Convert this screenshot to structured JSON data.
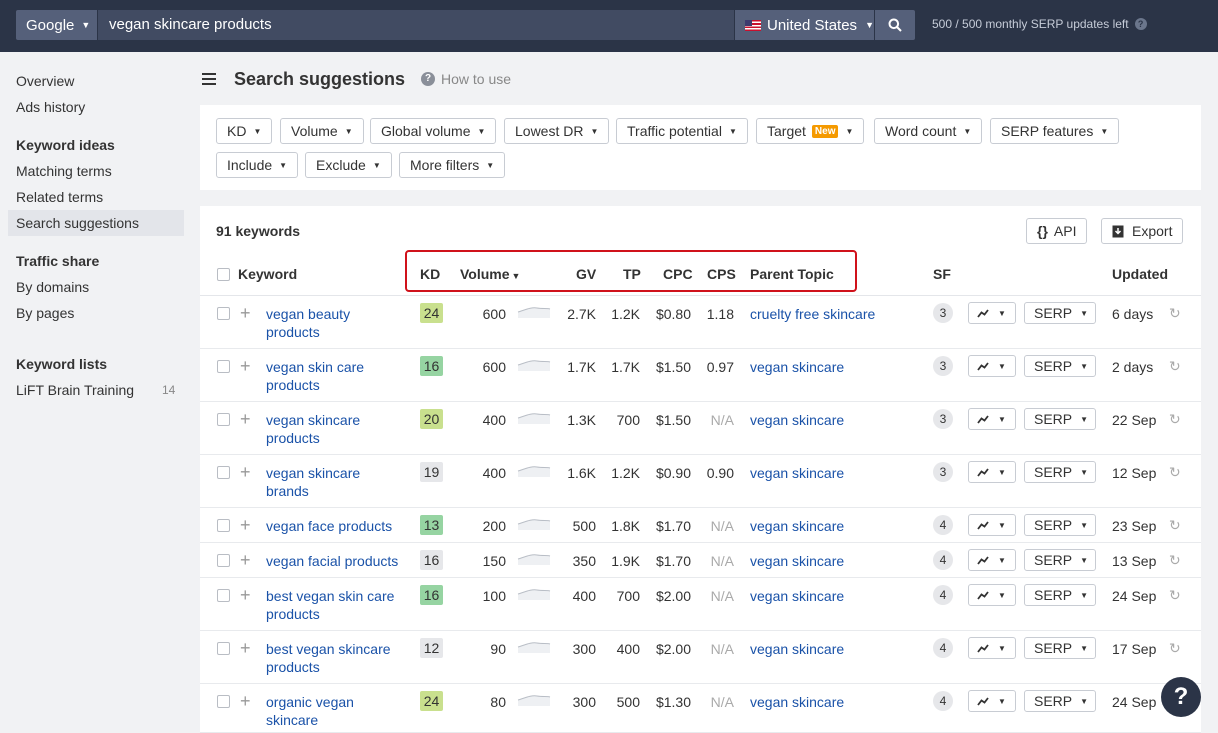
{
  "topbar": {
    "engine": "Google",
    "query": "vegan skincare products",
    "country": "United States",
    "quota": "500 / 500 monthly SERP updates left"
  },
  "sidebar": {
    "items": [
      {
        "label": "Overview"
      },
      {
        "label": "Ads history"
      }
    ],
    "keyword_ideas": {
      "heading": "Keyword ideas",
      "items": [
        {
          "label": "Matching terms"
        },
        {
          "label": "Related terms"
        },
        {
          "label": "Search suggestions"
        }
      ]
    },
    "traffic_share": {
      "heading": "Traffic share",
      "items": [
        {
          "label": "By domains"
        },
        {
          "label": "By pages"
        }
      ]
    },
    "keyword_lists": {
      "heading": "Keyword lists",
      "items": [
        {
          "label": "LiFT Brain Training",
          "count": "14"
        }
      ]
    }
  },
  "header": {
    "title": "Search suggestions",
    "how_to": "How to use"
  },
  "filters": [
    {
      "label": "KD"
    },
    {
      "label": "Volume"
    },
    {
      "label": "Global volume"
    },
    {
      "label": "Lowest DR"
    },
    {
      "label": "Traffic potential"
    },
    {
      "label": "Target",
      "badge": "New"
    },
    {
      "label": "Word count"
    },
    {
      "label": "SERP features"
    },
    {
      "label": "Include"
    },
    {
      "label": "Exclude"
    },
    {
      "label": "More filters"
    }
  ],
  "table": {
    "count": "91 keywords",
    "api_label": "API",
    "export_label": "Export",
    "headers": {
      "keyword": "Keyword",
      "kd": "KD",
      "volume": "Volume",
      "gv": "GV",
      "tp": "TP",
      "cpc": "CPC",
      "cps": "CPS",
      "parent": "Parent Topic",
      "sf": "SF",
      "updated": "Updated"
    },
    "serp_label": "SERP",
    "rows": [
      {
        "kw1": "vegan beauty",
        "kw2": "products",
        "kd": "24",
        "kd_color": "#c9e08e",
        "volume": "600",
        "gv": "2.7K",
        "tp": "1.2K",
        "cpc": "$0.80",
        "cps": "1.18",
        "parent": "cruelty free skincare",
        "sf": "3",
        "updated": "6 days"
      },
      {
        "kw1": "vegan skin care",
        "kw2": "products",
        "kd": "16",
        "kd_color": "#96d4a2",
        "volume": "600",
        "gv": "1.7K",
        "tp": "1.7K",
        "cpc": "$1.50",
        "cps": "0.97",
        "parent": "vegan skincare",
        "sf": "3",
        "updated": "2 days"
      },
      {
        "kw1": "vegan skincare",
        "kw2": "products",
        "kd": "20",
        "kd_color": "#c9e08e",
        "volume": "400",
        "gv": "1.3K",
        "tp": "700",
        "cpc": "$1.50",
        "cps": "N/A",
        "parent": "vegan skincare",
        "sf": "3",
        "updated": "22 Sep"
      },
      {
        "kw1": "vegan skincare",
        "kw2": "brands",
        "kd": "19",
        "kd_color": "#e6e7ea",
        "volume": "400",
        "gv": "1.6K",
        "tp": "1.2K",
        "cpc": "$0.90",
        "cps": "0.90",
        "parent": "vegan skincare",
        "sf": "3",
        "updated": "12 Sep"
      },
      {
        "kw1": "vegan face products",
        "kw2": "",
        "kd": "13",
        "kd_color": "#96d4a2",
        "volume": "200",
        "gv": "500",
        "tp": "1.8K",
        "cpc": "$1.70",
        "cps": "N/A",
        "parent": "vegan skincare",
        "sf": "4",
        "updated": "23 Sep"
      },
      {
        "kw1": "vegan facial products",
        "kw2": "",
        "kd": "16",
        "kd_color": "#e6e7ea",
        "volume": "150",
        "gv": "350",
        "tp": "1.9K",
        "cpc": "$1.70",
        "cps": "N/A",
        "parent": "vegan skincare",
        "sf": "4",
        "updated": "13 Sep"
      },
      {
        "kw1": "best vegan skin care",
        "kw2": "products",
        "kd": "16",
        "kd_color": "#96d4a2",
        "volume": "100",
        "gv": "400",
        "tp": "700",
        "cpc": "$2.00",
        "cps": "N/A",
        "parent": "vegan skincare",
        "sf": "4",
        "updated": "24 Sep"
      },
      {
        "kw1": "best vegan skincare",
        "kw2": "products",
        "kd": "12",
        "kd_color": "#e6e7ea",
        "volume": "90",
        "gv": "300",
        "tp": "400",
        "cpc": "$2.00",
        "cps": "N/A",
        "parent": "vegan skincare",
        "sf": "4",
        "updated": "17 Sep"
      },
      {
        "kw1": "organic vegan",
        "kw2": "skincare",
        "kd": "24",
        "kd_color": "#c9e08e",
        "volume": "80",
        "gv": "300",
        "tp": "500",
        "cpc": "$1.30",
        "cps": "N/A",
        "parent": "vegan skincare",
        "sf": "4",
        "updated": "24 Sep"
      }
    ]
  },
  "help_fab": "?"
}
